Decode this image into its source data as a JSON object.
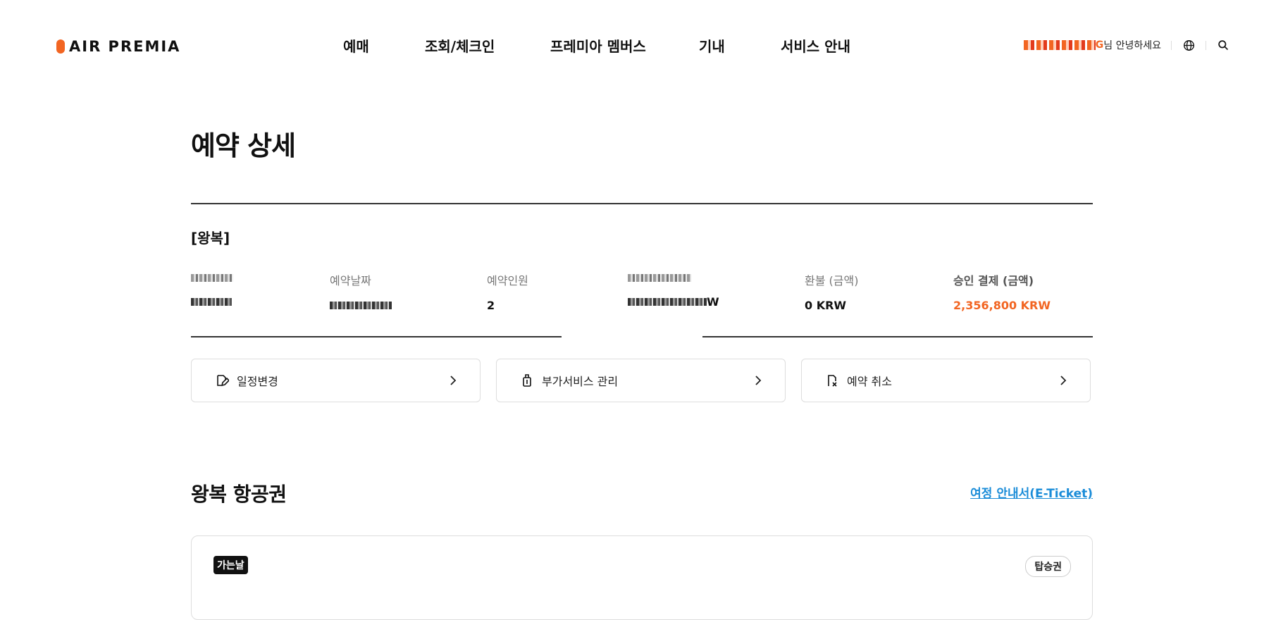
{
  "header": {
    "logo_text": "AIR PREMIA",
    "nav": [
      "예매",
      "조회/체크인",
      "프레미아 멤버스",
      "기내",
      "서비스 안내"
    ],
    "user_suffix": "G",
    "greeting": "님 안녕하세요"
  },
  "page": {
    "title": "예약 상세",
    "trip_type": "[왕복]"
  },
  "booking_info": {
    "label_2": "예약날짜",
    "label_3": "예약인원",
    "value_3": "2",
    "value_4_suffix": "W",
    "label_5": "환불 (금액)",
    "value_5": "0 KRW",
    "label_6": "승인 결제 (금액)",
    "value_6": "2,356,800 KRW"
  },
  "actions": [
    {
      "label": "일정변경",
      "icon": "edit-icon"
    },
    {
      "label": "부가서비스 관리",
      "icon": "luggage-icon"
    },
    {
      "label": "예약 취소",
      "icon": "cancel-document-icon"
    }
  ],
  "tickets": {
    "section_title": "왕복 항공권",
    "eticket_link": "여정 안내서(E-Ticket)",
    "card": {
      "direction_badge": "가는날",
      "boarding_pass": "탑승권"
    }
  },
  "colors": {
    "brand": "#f26522",
    "link": "#1a8cd8"
  }
}
